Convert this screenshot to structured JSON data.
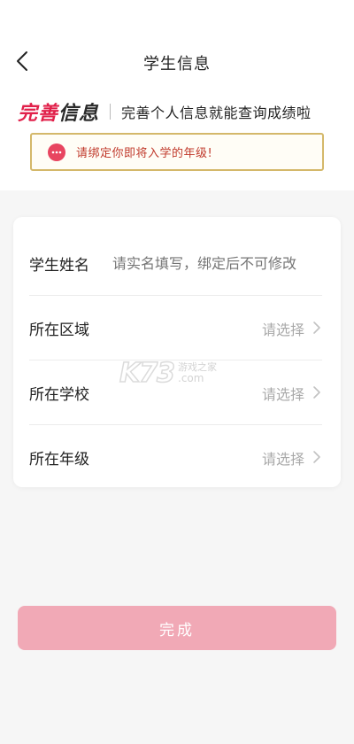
{
  "header": {
    "title": "学生信息",
    "back_icon": "chevron-left-icon"
  },
  "banner": {
    "brand_part1": "完善",
    "brand_part2": "信息",
    "subtitle": "完善个人信息就能查询成绩啦",
    "brand_color": "#e1204a"
  },
  "notice": {
    "icon": "chat-bubble-icon",
    "text": "请绑定你即将入学的年级!",
    "border_color": "#d4b86a"
  },
  "form": {
    "name": {
      "label": "学生姓名",
      "placeholder": "请实名填写，绑定后不可修改"
    },
    "region": {
      "label": "所在区域",
      "value": "请选择"
    },
    "school": {
      "label": "所在学校",
      "value": "请选择"
    },
    "grade": {
      "label": "所在年级",
      "value": "请选择"
    }
  },
  "watermark": {
    "logo": "K73",
    "text_cn": "游戏之家",
    "text_com": ".com"
  },
  "submit": {
    "label": "完成",
    "color": "#f1a9b6"
  }
}
